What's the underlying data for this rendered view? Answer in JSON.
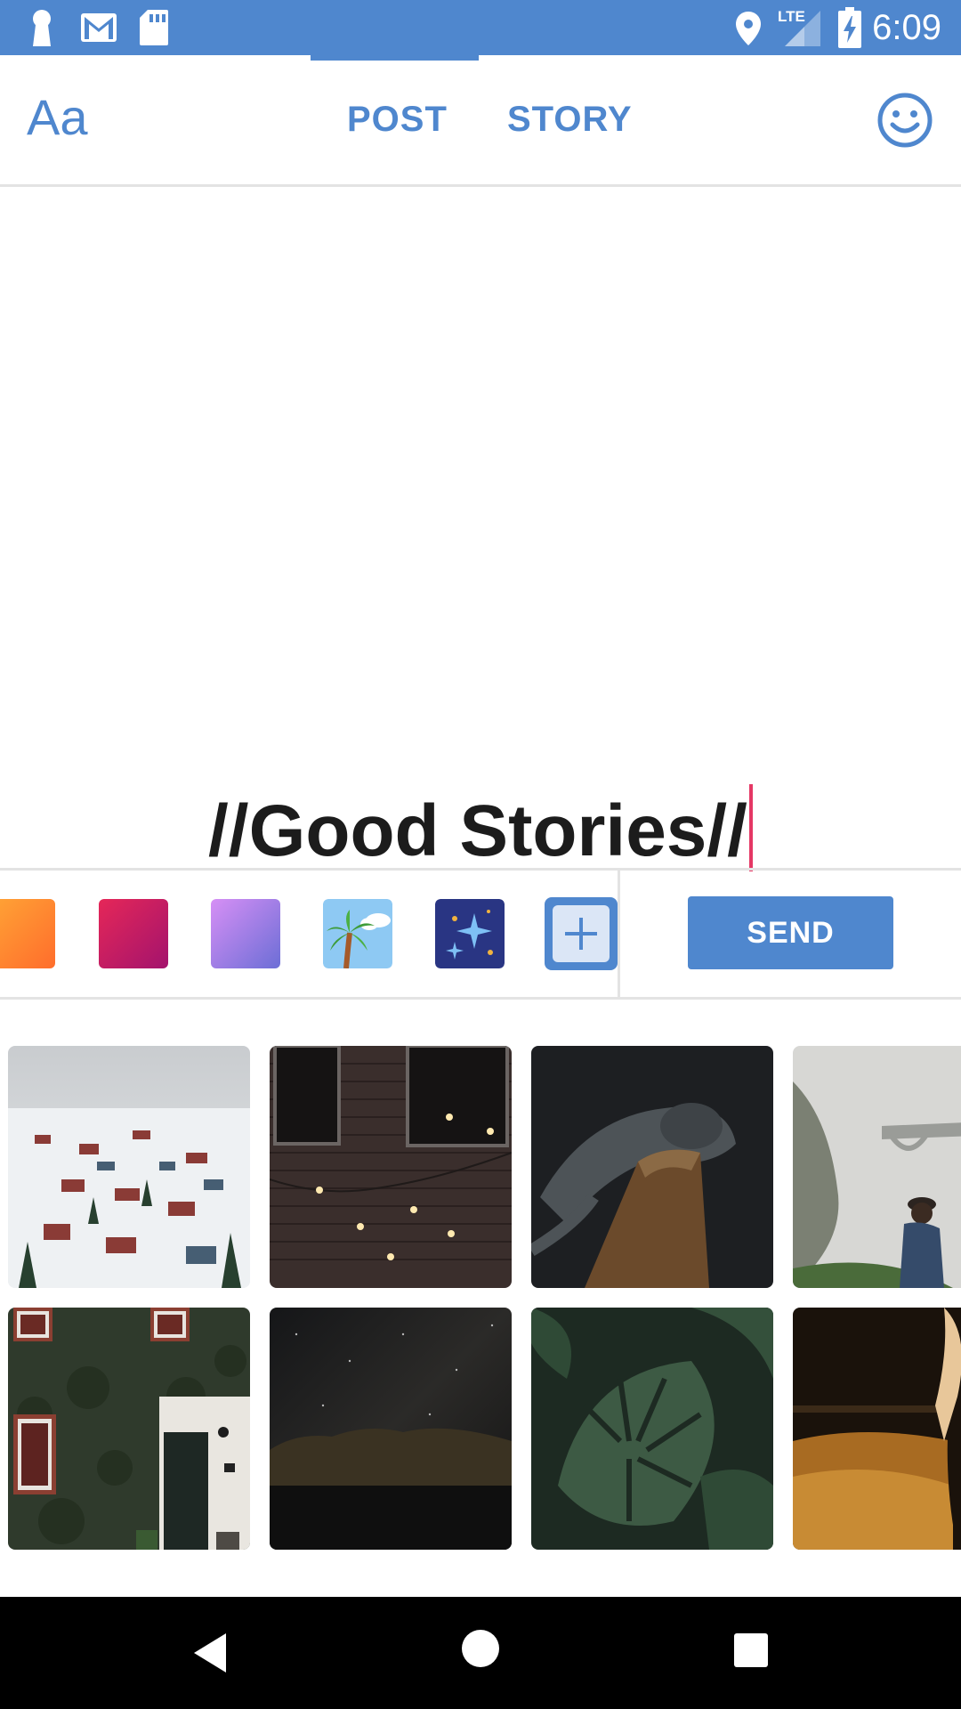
{
  "status_bar": {
    "time": "6:09",
    "network": "LTE",
    "icons": [
      "keyhole-icon",
      "gmail-icon",
      "sd-card-icon",
      "location-icon",
      "signal-icon",
      "battery-charging-icon"
    ]
  },
  "header": {
    "font_button_label": "Aa",
    "tabs": [
      {
        "label": "POST",
        "selected": true
      },
      {
        "label": "STORY",
        "selected": false
      }
    ],
    "emoji_icon": "smiley-icon"
  },
  "composer": {
    "text": "//Good Stories//"
  },
  "backgrounds": {
    "swatches": [
      {
        "name": "orange-gradient",
        "colors": [
          "#FFA636",
          "#FF6D2C"
        ]
      },
      {
        "name": "pink-gradient",
        "colors": [
          "#E52758",
          "#A3136D"
        ]
      },
      {
        "name": "purple-gradient",
        "colors": [
          "#D68FF5",
          "#6C6ED6"
        ]
      },
      {
        "name": "palm-tree-image",
        "colors": [
          "#9FD4F5",
          "#6BB4EE"
        ]
      },
      {
        "name": "sparkles-image",
        "colors": [
          "#293583",
          "#2B2E6E"
        ]
      }
    ],
    "add_icon": "plus-icon"
  },
  "send_button_label": "SEND",
  "gallery": {
    "photos": [
      {
        "subject": "snowy-village"
      },
      {
        "subject": "brick-wall-lights"
      },
      {
        "subject": "sleeping-cat"
      },
      {
        "subject": "foggy-bridge-hiker"
      },
      {
        "subject": "ivy-house"
      },
      {
        "subject": "night-sky-mountain"
      },
      {
        "subject": "monstera-leaves"
      },
      {
        "subject": "horse-golden-field"
      }
    ]
  },
  "colors": {
    "accent": "#4F87CE",
    "caret": "#E53865"
  },
  "nav_bar": {
    "buttons": [
      "back-icon",
      "home-icon",
      "recents-icon"
    ]
  }
}
